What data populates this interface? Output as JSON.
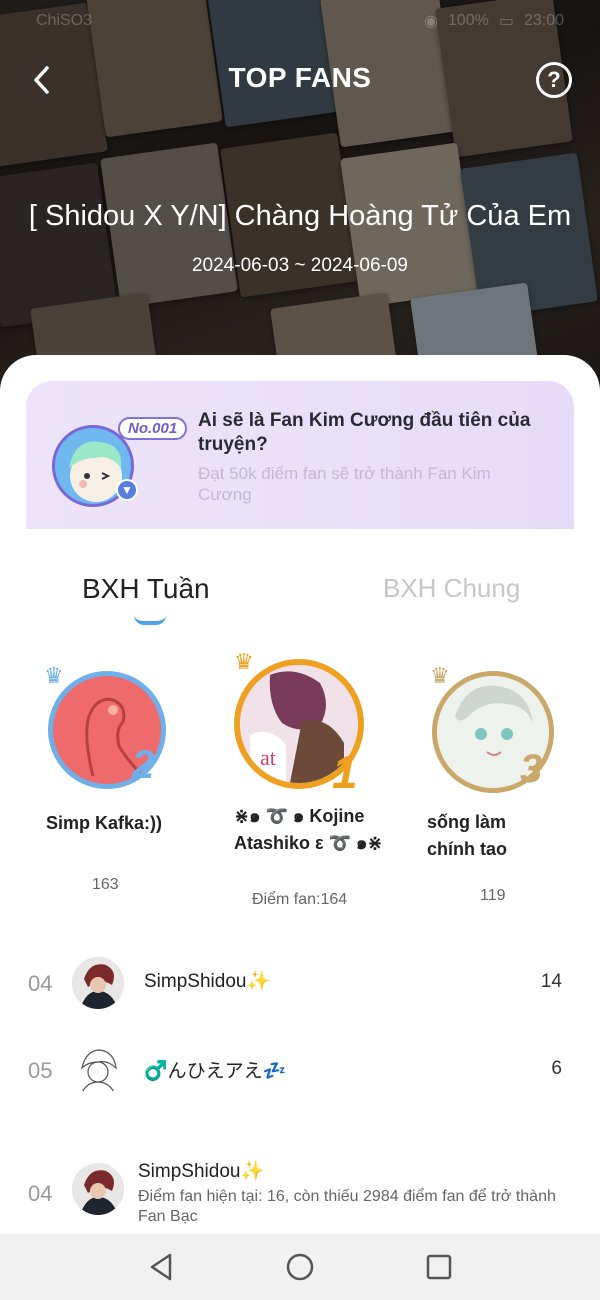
{
  "status": {
    "carrier": "ChiSO3",
    "battery": "100%",
    "time": "23:00"
  },
  "header": {
    "title": "TOP FANS",
    "story_title": "[ Shidou X Y/N] Chàng Hoàng Tử Của Em",
    "date_range": "2024-06-03 ~ 2024-06-09"
  },
  "promo": {
    "badge": "No.001",
    "question": "Ai sẽ là Fan Kim Cương đầu tiên của truyện?",
    "subtitle": "Đạt 50k điểm fan sẽ trở thành Fan Kim Cương"
  },
  "tabs": {
    "week": "BXH Tuần",
    "all": "BXH Chung"
  },
  "podium": {
    "first": {
      "rank": "1",
      "name": "⋇๑ ➰ ๑ Kojine Atashiko ε ➰ ๑⋇",
      "score": "Điểm fan:164"
    },
    "second": {
      "rank": "2",
      "name": "Simp Kafka:))",
      "score": "163"
    },
    "third": {
      "rank": "3",
      "name": "sống làm chính tao",
      "score": "119"
    }
  },
  "rows": [
    {
      "rank": "04",
      "name": "SimpShidou✨",
      "score": "14"
    },
    {
      "rank": "05",
      "name": "♂️んひえアえ💤",
      "score": "6"
    }
  ],
  "me": {
    "rank": "04",
    "name": "SimpShidou✨",
    "info": "Điểm fan hiện tại: 16, còn thiếu 2984 điểm fan để trở thành Fan Bạc"
  },
  "colors": {
    "accent": "#4ea3e6",
    "gold": "#f0a020",
    "silver": "#6fb0ea",
    "bronze": "#c9a86a",
    "promo_bg": "#ede4fb"
  }
}
